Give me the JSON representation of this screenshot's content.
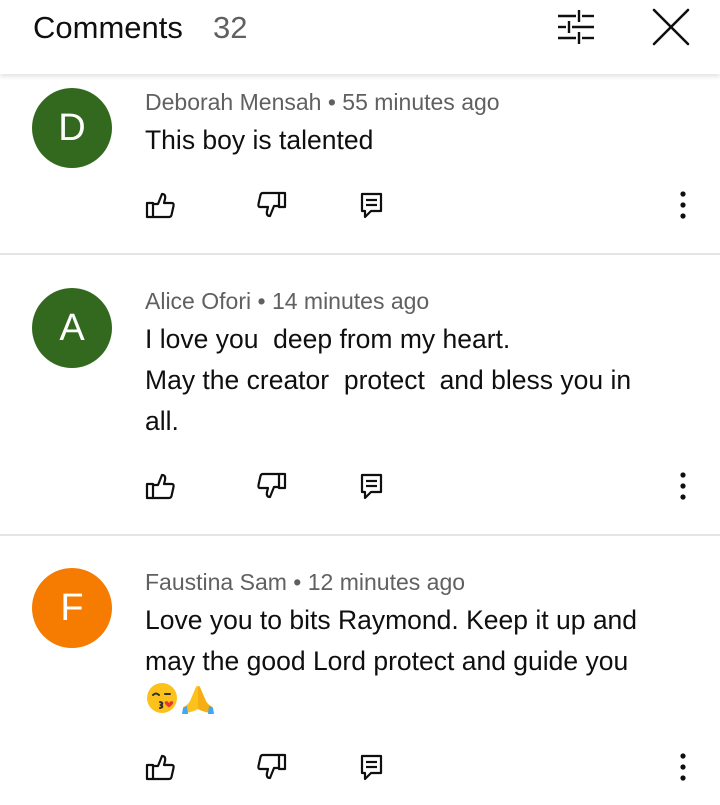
{
  "header": {
    "title": "Comments",
    "count": "32"
  },
  "icons": {
    "filter": "sliders-filter-icon",
    "close": "close-x-icon",
    "like": "thumbs-up-outline-icon",
    "dislike": "thumbs-down-outline-icon",
    "reply": "reply-comment-icon",
    "more": "vertical-ellipsis-icon"
  },
  "colors": {
    "avatar_green": "#33691e",
    "avatar_orange": "#f57c00",
    "meta_gray": "#606060",
    "divider": "#e5e5e5"
  },
  "comments": [
    {
      "initial": "D",
      "author": "Deborah Mensah",
      "separator": "•",
      "time": "55 minutes ago",
      "lines": [
        "This boy is talented"
      ]
    },
    {
      "initial": "A",
      "author": "Alice Ofori",
      "separator": "•",
      "time": "14 minutes ago",
      "lines": [
        "I love you  deep from my heart.",
        "May the creator  protect  and bless you in",
        "all."
      ]
    },
    {
      "initial": "F",
      "author": "Faustina Sam",
      "separator": "•",
      "time": "12 minutes ago",
      "lines": [
        "Love you to bits Raymond. Keep it up and",
        "may the good Lord protect and guide you"
      ],
      "emojis": [
        "😘",
        "🙏"
      ]
    }
  ]
}
